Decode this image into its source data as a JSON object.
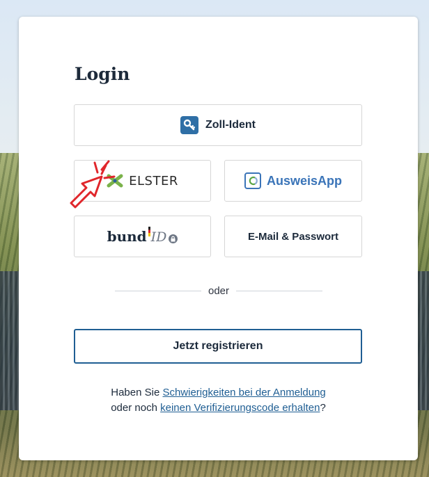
{
  "login": {
    "title": "Login",
    "buttons": {
      "zoll_ident": "Zoll-Ident",
      "elster": "ELSTER",
      "ausweisapp": "AusweisApp",
      "bundid_word": "bund",
      "bundid_id": "ID",
      "email": "E-Mail & Passwort"
    },
    "divider": "oder",
    "register": "Jetzt registrieren",
    "help": {
      "line1_prefix": "Haben Sie ",
      "line1_link": "Schwierigkeiten bei der Anmeldung",
      "line2_prefix": "oder noch ",
      "line2_link": "keinen Verifizierungscode erhalten",
      "line2_suffix": "?"
    }
  },
  "icons": {
    "zoll": "key-icon",
    "elster": "elster-logo-icon",
    "ausweis": "ausweisapp-icon",
    "lock": "lock-icon",
    "cursor": "click-pointer-icon"
  },
  "colors": {
    "accent": "#1f5e93",
    "zoll_icon": "#2f6fa6",
    "ausweis": "#3a74b8",
    "elster_green": "#7ab24a"
  }
}
